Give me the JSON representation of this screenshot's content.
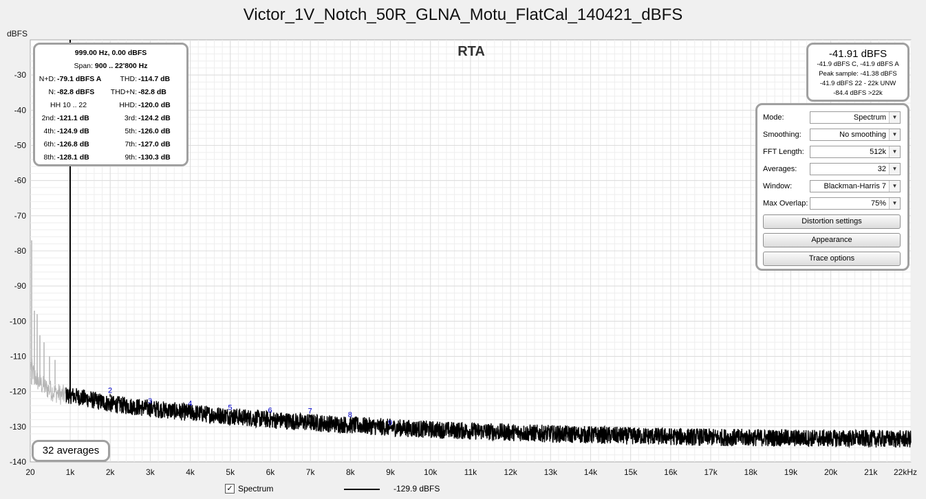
{
  "title": "Victor_1V_Notch_50R_GLNA_Motu_FlatCal_140421_dBFS",
  "y_unit": "dBFS",
  "x_unit": "22kHz",
  "rta_label": "RTA",
  "distortion": {
    "header": "999.00 Hz, 0.00 dBFS",
    "span_label": "Span:",
    "span_value": "900 .. 22'800 Hz",
    "rows": [
      {
        "l1": "N+D:",
        "v1": "-79.1 dBFS A",
        "l2": "THD:",
        "v2": "-114.7 dB"
      },
      {
        "l1": "N:",
        "v1": "-82.8 dBFS",
        "l2": "THD+N:",
        "v2": "-82.8 dB"
      },
      {
        "l1": "HH 10 .. 22",
        "v1": "",
        "l2": "HHD:",
        "v2": "-120.0 dB"
      },
      {
        "l1": "2nd:",
        "v1": "-121.1 dB",
        "l2": "3rd:",
        "v2": "-124.2 dB"
      },
      {
        "l1": "4th:",
        "v1": "-124.9 dB",
        "l2": "5th:",
        "v2": "-126.0 dB"
      },
      {
        "l1": "6th:",
        "v1": "-126.8 dB",
        "l2": "7th:",
        "v2": "-127.0 dB"
      },
      {
        "l1": "8th:",
        "v1": "-128.1 dB",
        "l2": "9th:",
        "v2": "-130.3 dB"
      }
    ]
  },
  "level": {
    "main": "-41.91 dBFS",
    "lines": [
      "-41.9 dBFS C, -41.9 dBFS A",
      "Peak sample: -41.38 dBFS",
      "-41.9 dBFS 22 - 22k UNW",
      "-84.4 dBFS >22k"
    ]
  },
  "controls": {
    "mode_label": "Mode:",
    "mode_value": "Spectrum",
    "smoothing_label": "Smoothing:",
    "smoothing_value": "No  smoothing",
    "fft_label": "FFT Length:",
    "fft_value": "512k",
    "averages_label": "Averages:",
    "averages_value": "32",
    "window_label": "Window:",
    "window_value": "Blackman-Harris 7",
    "overlap_label": "Max Overlap:",
    "overlap_value": "75%",
    "distortion_button": "Distortion settings",
    "appearance_button": "Appearance",
    "trace_button": "Trace options"
  },
  "averages_badge": "32 averages",
  "legend": {
    "checked": true,
    "series_name": "Spectrum",
    "value": "-129.9 dBFS"
  },
  "colors": {
    "trace": "#000000",
    "out_of_span_trace": "#b4b4b4",
    "harmonic_marker": "#0000cc",
    "grid": "#dcdcdc"
  },
  "chart_data": {
    "type": "line",
    "x_unit": "Hz",
    "y_unit": "dBFS",
    "xlim": [
      20,
      22000
    ],
    "ylim": [
      -140,
      -20
    ],
    "x_ticks": [
      20,
      1000,
      2000,
      3000,
      4000,
      5000,
      6000,
      7000,
      8000,
      9000,
      10000,
      11000,
      12000,
      13000,
      14000,
      15000,
      16000,
      17000,
      18000,
      19000,
      20000,
      21000,
      22000
    ],
    "x_tick_labels": [
      "20",
      "1k",
      "2k",
      "3k",
      "4k",
      "5k",
      "6k",
      "7k",
      "8k",
      "9k",
      "10k",
      "11k",
      "12k",
      "13k",
      "14k",
      "15k",
      "16k",
      "17k",
      "18k",
      "19k",
      "20k",
      "21k",
      "22kHz"
    ],
    "y_ticks": [
      -30,
      -40,
      -50,
      -60,
      -70,
      -80,
      -90,
      -100,
      -110,
      -120,
      -130,
      -140
    ],
    "grid": true,
    "series": [
      {
        "name": "Spectrum",
        "x": [
          900,
          1000,
          2000,
          3000,
          4000,
          5000,
          6000,
          7000,
          8000,
          9000,
          10000,
          11000,
          12000,
          13000,
          14000,
          15000,
          16000,
          17000,
          18000,
          19000,
          20000,
          21000,
          22000
        ],
        "y": [
          -121,
          -121,
          -123.5,
          -124.8,
          -126,
          -127,
          -128,
          -128.8,
          -129.5,
          -130.2,
          -130.8,
          -131.2,
          -131.6,
          -132,
          -132.3,
          -132.6,
          -132.8,
          -133,
          -133.1,
          -133.2,
          -133.3,
          -133.4,
          -133.5
        ],
        "fundamental": {
          "x": 999,
          "y": 0
        }
      }
    ],
    "out_of_span": {
      "x": [
        20,
        100,
        200,
        300,
        400,
        500,
        600,
        700,
        800,
        900
      ],
      "y": [
        -112,
        -115,
        -117,
        -118,
        -119,
        -119.5,
        -120,
        -120.5,
        -121,
        -121
      ]
    },
    "harmonics": [
      {
        "label": "2",
        "x": 1998,
        "y": -121.1
      },
      {
        "label": "3",
        "x": 2997,
        "y": -124.2
      },
      {
        "label": "4",
        "x": 3996,
        "y": -124.9
      },
      {
        "label": "5",
        "x": 4995,
        "y": -126.0
      },
      {
        "label": "6",
        "x": 5994,
        "y": -126.8
      },
      {
        "label": "7",
        "x": 6993,
        "y": -127.0
      },
      {
        "label": "8",
        "x": 7992,
        "y": -128.1
      },
      {
        "label": "9",
        "x": 8991,
        "y": -130.3
      }
    ]
  }
}
